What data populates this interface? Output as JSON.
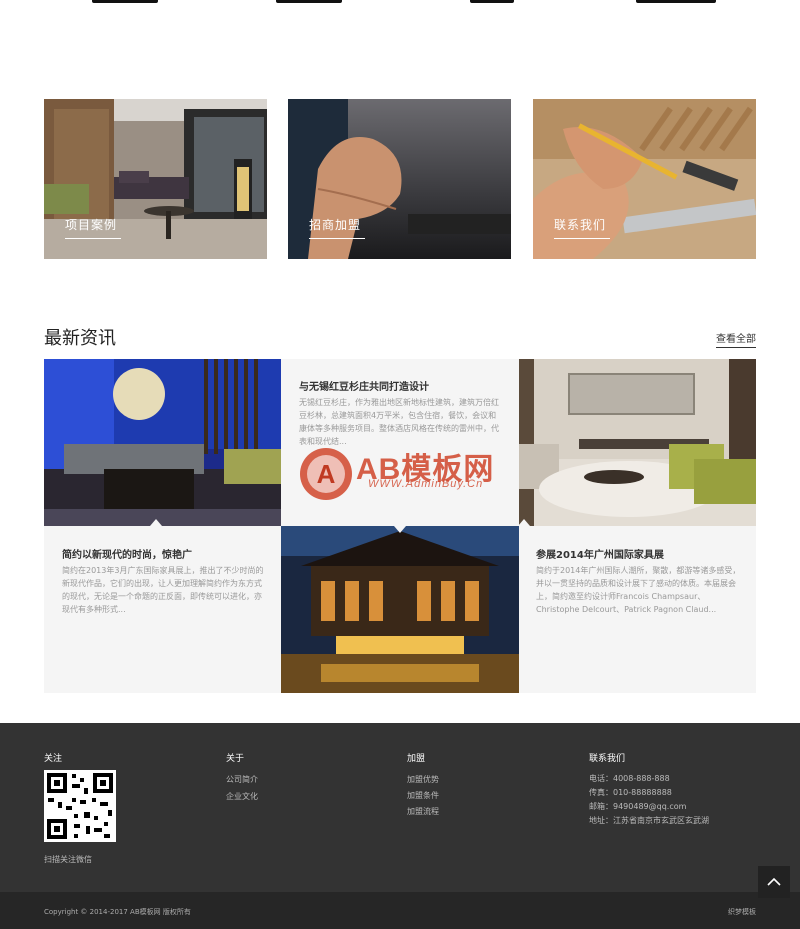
{
  "colors": {
    "footer_bg": "#333333",
    "bottom_bar_bg": "#262626",
    "tile_bg": "#f5f5f5",
    "accent_watermark": "#d0452a"
  },
  "categories": [
    {
      "label": "项目案例",
      "icon": "living-room-photo"
    },
    {
      "label": "招商加盟",
      "icon": "handshake-photo"
    },
    {
      "label": "联系我们",
      "icon": "woodwork-photo"
    }
  ],
  "news": {
    "title": "最新资讯",
    "more": "查看全部",
    "items": [
      {
        "title": "简约以新现代的时尚，惊艳广",
        "excerpt": "简约在2013年3月广东国际家具展上，推出了不少时尚的新现代作品，它们的出现，让人更加理解简约作为东方式的现代，无论是一个命题的正反面，即传统可以进化，亦现代有多种形式..."
      },
      {
        "title": "与无锡红豆杉庄共同打造设计",
        "excerpt": "无锡红豆杉庄，作为雅出地区新地标性建筑，建筑万倍红豆杉林，总建筑面积4万平米，包含住宿，餐饮，会议和康体等多种服务项目。整体酒店风格在传统的雷州中，代表和现代结..."
      },
      {
        "title": "参展2014年广州国际家具展",
        "excerpt": "简约于2014年广州国际人潮所，聚散，都游等诸多感受，并以一贯坚持的品质和设计展下了感动的体质。本届展会上，简约邀至约设计师Francois Champsaur、Christophe Delcourt、Patrick Pagnon Claud..."
      }
    ]
  },
  "watermark": {
    "brand": "AB模板网",
    "url": "WWW.AdminBuy.Cn",
    "letter": "A"
  },
  "footer": {
    "follow": {
      "title": "关注",
      "qr_caption": "扫描关注微信"
    },
    "about": {
      "title": "关于",
      "links": [
        "公司简介",
        "企业文化"
      ]
    },
    "join": {
      "title": "加盟",
      "links": [
        "加盟优势",
        "加盟条件",
        "加盟流程"
      ]
    },
    "contact": {
      "title": "联系我们",
      "lines": [
        "电话：4008-888-888",
        "传真：010-88888888",
        "邮箱：9490489@qq.com",
        "地址：江苏省南京市玄武区玄武湖"
      ]
    },
    "copyright": "Copyright © 2014-2017 AB模板网 版权所有",
    "brand_right": "织梦模板"
  }
}
